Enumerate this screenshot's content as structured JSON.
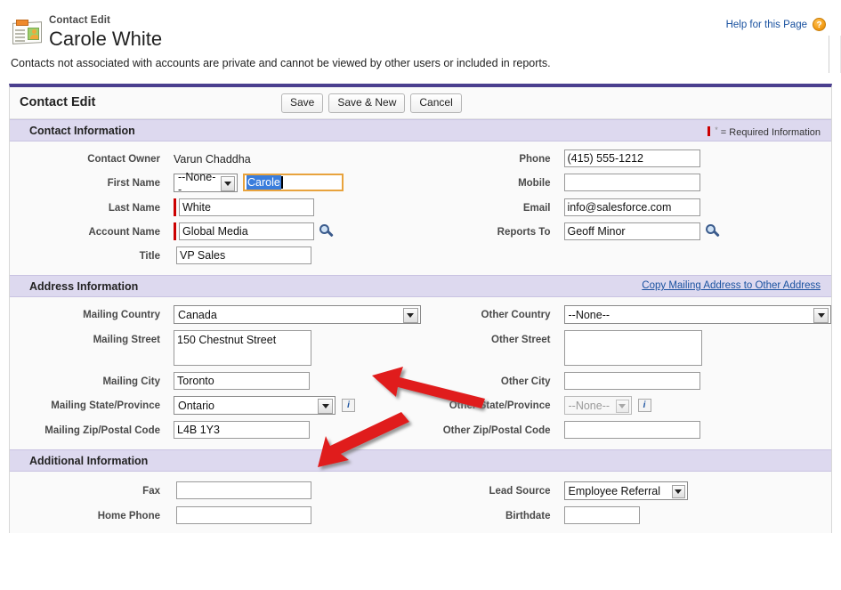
{
  "header": {
    "eyebrow": "Contact Edit",
    "title": "Carole White",
    "help_link": "Help for this Page",
    "help_icon": "question-mark-icon",
    "record_icon": "contact-card-icon"
  },
  "notice": "Contacts not associated with accounts are private and cannot be viewed by other users or included in reports.",
  "toolbar": {
    "title": "Contact Edit",
    "save_label": "Save",
    "save_new_label": "Save & New",
    "cancel_label": "Cancel"
  },
  "sections": {
    "contact_information": {
      "title": "Contact Information",
      "required_note": "= Required Information",
      "fields": {
        "contact_owner": {
          "label": "Contact Owner",
          "value": "Varun Chaddha"
        },
        "first_name": {
          "label": "First Name",
          "salutation": "--None--",
          "value": "Carole"
        },
        "last_name": {
          "label": "Last Name",
          "value": "White"
        },
        "account_name": {
          "label": "Account Name",
          "value": "Global Media",
          "lookup_icon": "search-lookup-icon"
        },
        "title": {
          "label": "Title",
          "value": "VP Sales"
        },
        "phone": {
          "label": "Phone",
          "value": "(415) 555-1212"
        },
        "mobile": {
          "label": "Mobile",
          "value": ""
        },
        "email": {
          "label": "Email",
          "value": "info@salesforce.com"
        },
        "reports_to": {
          "label": "Reports To",
          "value": "Geoff Minor",
          "lookup_icon": "search-lookup-icon"
        }
      }
    },
    "address_information": {
      "title": "Address Information",
      "copy_link": "Copy Mailing Address to Other Address",
      "fields": {
        "mailing_country": {
          "label": "Mailing Country",
          "value": "Canada"
        },
        "mailing_street": {
          "label": "Mailing Street",
          "value": "150 Chestnut Street"
        },
        "mailing_city": {
          "label": "Mailing City",
          "value": "Toronto"
        },
        "mailing_state": {
          "label": "Mailing State/Province",
          "value": "Ontario",
          "info_icon": "info-icon"
        },
        "mailing_zip": {
          "label": "Mailing Zip/Postal Code",
          "value": "L4B 1Y3"
        },
        "other_country": {
          "label": "Other Country",
          "value": "--None--"
        },
        "other_street": {
          "label": "Other Street",
          "value": ""
        },
        "other_city": {
          "label": "Other City",
          "value": ""
        },
        "other_state": {
          "label": "Other State/Province",
          "value": "--None--",
          "info_icon": "info-icon"
        },
        "other_zip": {
          "label": "Other Zip/Postal Code",
          "value": ""
        }
      }
    },
    "additional_information": {
      "title": "Additional Information",
      "fields": {
        "fax": {
          "label": "Fax",
          "value": ""
        },
        "home_phone": {
          "label": "Home Phone",
          "value": ""
        },
        "lead_source": {
          "label": "Lead Source",
          "value": "Employee Referral"
        },
        "birthdate": {
          "label": "Birthdate",
          "value": ""
        }
      }
    }
  },
  "annotations": {
    "arrow_color": "#e01b1b",
    "arrow_country_target": "mailing-country-dropdown",
    "arrow_state_target": "mailing-state-dropdown"
  },
  "colors": {
    "accent_purple": "#4b3f8f",
    "section_header_bg": "#ddd9ef",
    "required_red": "#cc0000",
    "link_blue": "#1a52a0",
    "focus_orange": "#e8a33d",
    "selection_blue": "#3a7ddc"
  }
}
